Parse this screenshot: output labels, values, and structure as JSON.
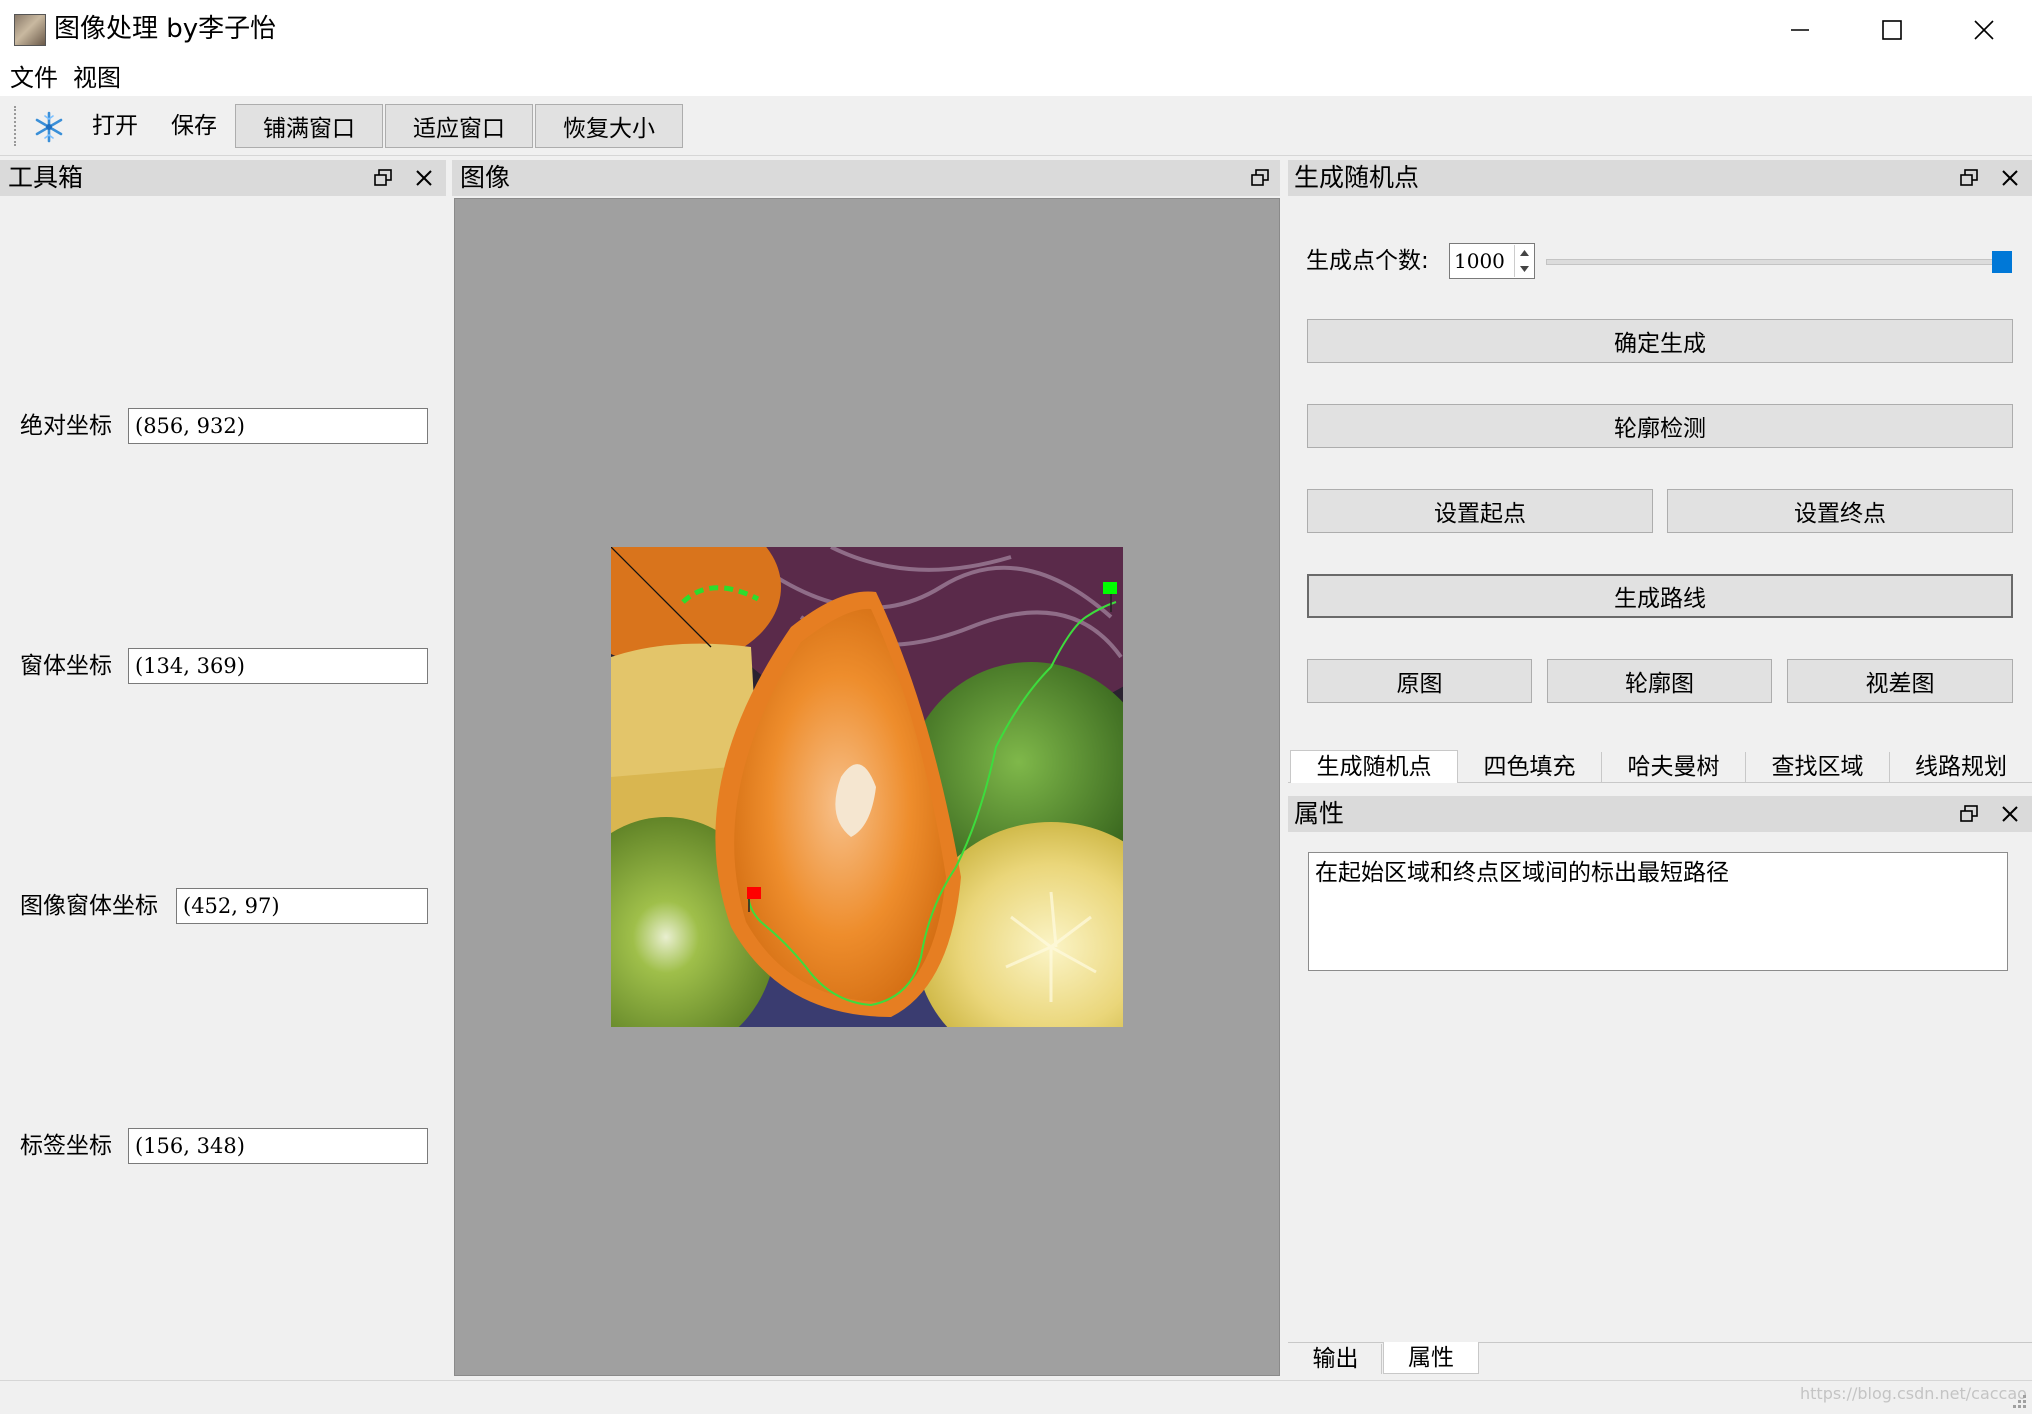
{
  "window": {
    "title": "图像处理 by李子怡",
    "minimize_icon": "minimize-icon",
    "maximize_icon": "maximize-icon",
    "close_icon": "close-icon"
  },
  "menubar": {
    "items": [
      {
        "label": "文件"
      },
      {
        "label": "视图"
      }
    ]
  },
  "toolbar": {
    "app_icon": "snowflake-icon",
    "open_label": "打开",
    "save_label": "保存",
    "fill_window_label": "铺满窗口",
    "fit_window_label": "适应窗口",
    "restore_size_label": "恢复大小"
  },
  "toolbox": {
    "title": "工具箱",
    "fields": [
      {
        "label": "绝对坐标",
        "value": "(856, 932)"
      },
      {
        "label": "窗体坐标",
        "value": "(134, 369)"
      },
      {
        "label": "图像窗体坐标",
        "value": "(452, 97)"
      },
      {
        "label": "标签坐标",
        "value": "(156, 348)"
      }
    ]
  },
  "image_panel": {
    "title": "图像",
    "image_content": "fruit-still-life-photo-with-shortest-path"
  },
  "random_points": {
    "title": "生成随机点",
    "count_label": "生成点个数:",
    "count_value": "1000",
    "slider_level": 1.0,
    "confirm_label": "确定生成",
    "contour_label": "轮廓检测",
    "set_start_label": "设置起点",
    "set_end_label": "设置终点",
    "route_label": "生成路线",
    "original_label": "原图",
    "contour_image_label": "轮廓图",
    "disparity_label": "视差图"
  },
  "tabs": [
    {
      "label": "生成随机点",
      "active": true
    },
    {
      "label": "四色填充",
      "active": false
    },
    {
      "label": "哈夫曼树",
      "active": false
    },
    {
      "label": "查找区域",
      "active": false
    },
    {
      "label": "线路规划",
      "active": false
    }
  ],
  "properties": {
    "title": "属性",
    "description": "在起始区域和终点区域间的标出最短路径"
  },
  "bottom_tabs": [
    {
      "label": "输出",
      "active": false
    },
    {
      "label": "属性",
      "active": true
    }
  ],
  "watermark": "https://blog.csdn.net/caccao",
  "colors": {
    "accent": "#0078d7",
    "path_green": "#3ddc3d",
    "start_red": "#ff0000",
    "end_green": "#00ff00"
  }
}
